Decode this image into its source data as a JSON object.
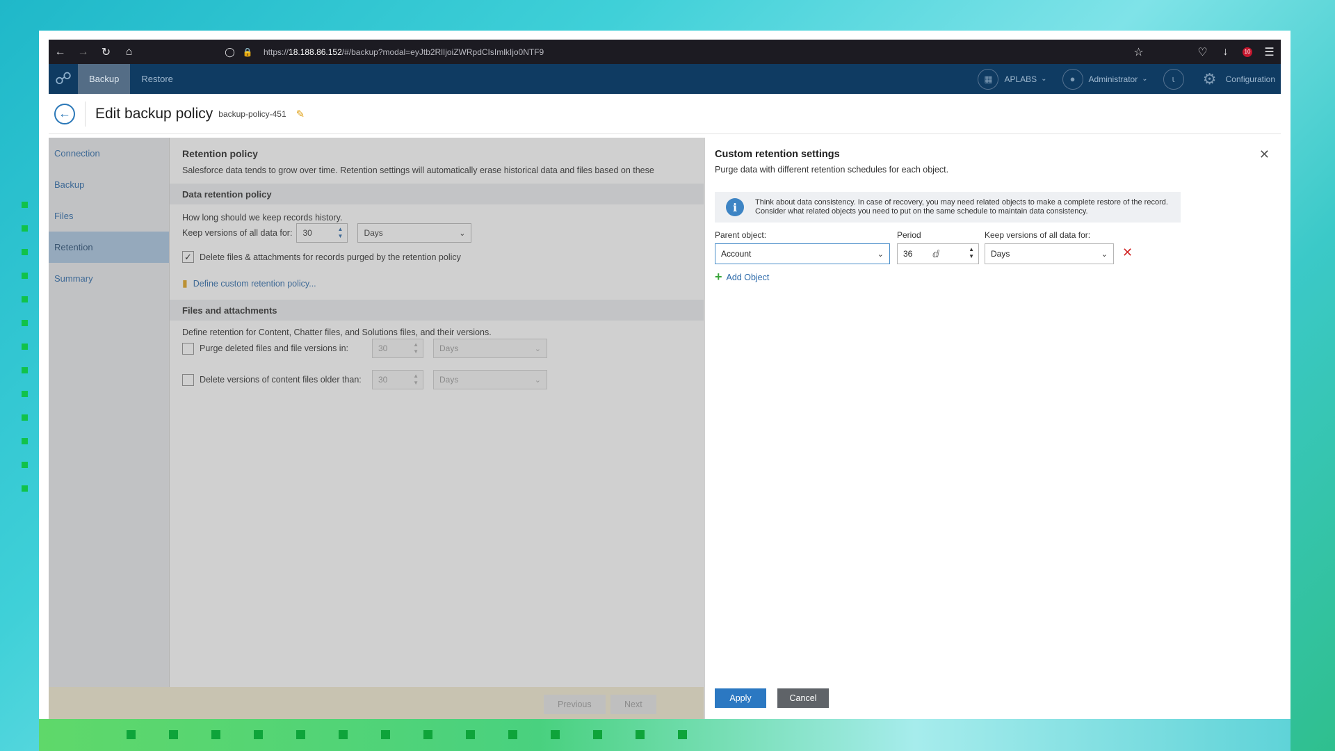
{
  "browser": {
    "url_prefix": "https://",
    "url_host": "18.188.86.152",
    "url_path": "/#/backup?modal=eyJtb2RlIjoiZWRpdCIsImlkIjo0NTF9",
    "ublock_count": "10"
  },
  "header": {
    "tabs": [
      {
        "label": "Backup"
      },
      {
        "label": "Restore"
      }
    ],
    "org": "APLABS",
    "user": "Administrator",
    "config": "Configuration"
  },
  "page": {
    "title": "Edit backup policy",
    "policy_name": "backup-policy-451"
  },
  "sidebar": {
    "items": [
      {
        "label": "Connection"
      },
      {
        "label": "Backup"
      },
      {
        "label": "Files"
      },
      {
        "label": "Retention"
      },
      {
        "label": "Summary"
      }
    ]
  },
  "retention": {
    "heading": "Retention policy",
    "description": "Salesforce data tends to grow over time. Retention settings will automatically erase historical data and files based on these",
    "data_section": "Data retention policy",
    "how_long": "How long should we keep records history.",
    "keep_label": "Keep versions of all data for:",
    "keep_value": "30",
    "keep_unit": "Days",
    "delete_files_label": "Delete files & attachments for records purged by the retention policy",
    "custom_link": "Define custom retention policy...",
    "files_section": "Files and attachments",
    "files_desc": "Define retention for Content, Chatter files, and Solutions files, and their versions.",
    "purge_label": "Purge deleted files and file versions in:",
    "purge_value": "30",
    "purge_unit": "Days",
    "delete_versions_label": "Delete versions of content files older than:",
    "delete_versions_value": "30",
    "delete_versions_unit": "Days"
  },
  "footer": {
    "previous": "Previous",
    "next": "Next"
  },
  "panel": {
    "title": "Custom retention settings",
    "subtitle": "Purge data with different retention schedules for each object.",
    "info": "Think about data consistency. In case of recovery, you may need related objects to make a complete restore of the record. Consider what related objects you need to put on the same schedule to maintain data consistency.",
    "parent_label": "Parent object:",
    "period_label": "Period",
    "keep_label": "Keep versions of all data for:",
    "row": {
      "parent": "Account",
      "period": "36",
      "unit": "Days"
    },
    "add_object": "Add Object",
    "apply": "Apply",
    "cancel": "Cancel"
  }
}
